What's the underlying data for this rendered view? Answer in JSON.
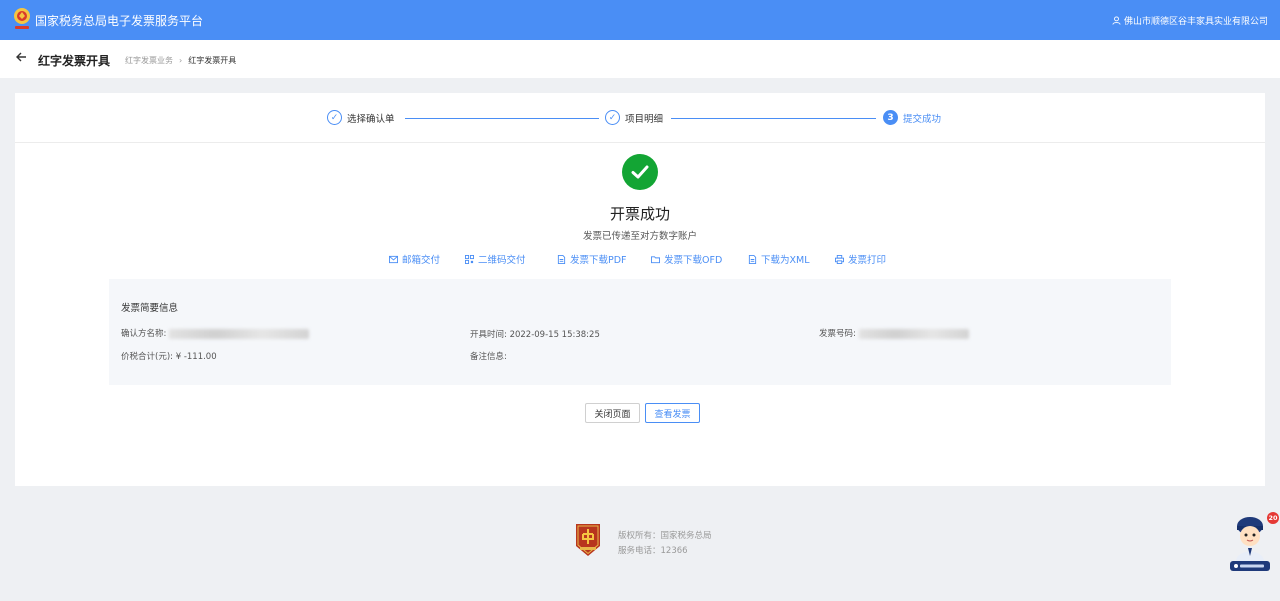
{
  "header": {
    "app_title": "国家税务总局电子发票服务平台",
    "user_company": "佛山市顺德区谷丰家具实业有限公司",
    "bg_color": "#4a8ef5"
  },
  "subheader": {
    "page_title": "红字发票开具",
    "breadcrumb": [
      "红字发票业务",
      "红字发票开具"
    ]
  },
  "steps": [
    {
      "label": "选择确认单",
      "state": "done"
    },
    {
      "label": "项目明细",
      "state": "done"
    },
    {
      "label": "提交成功",
      "state": "active",
      "index": "3"
    }
  ],
  "result": {
    "title": "开票成功",
    "subtitle": "发票已传递至对方数字账户",
    "accent_color": "#13a534"
  },
  "actions": [
    {
      "label": "邮箱交付",
      "icon": "mail-icon"
    },
    {
      "label": "二维码交付",
      "icon": "qrcode-icon"
    },
    {
      "label": "发票下载PDF",
      "icon": "document-icon"
    },
    {
      "label": "发票下载OFD",
      "icon": "folder-icon"
    },
    {
      "label": "下载为XML",
      "icon": "document-icon"
    },
    {
      "label": "发票打印",
      "icon": "printer-icon"
    }
  ],
  "invoice_info": {
    "title": "发票简要信息",
    "buyer_label": "确认方名称:",
    "issue_time_label": "开具时间:",
    "issue_time": "2022-09-15 15:38:25",
    "invoice_no_label": "发票号码:",
    "total_label": "价税合计(元):",
    "total_value": "¥ -111.00",
    "remark_label": "备注信息:"
  },
  "buttons": {
    "close": "关闭页面",
    "view": "查看发票"
  },
  "footer": {
    "copyright": "版权所有：国家税务总局",
    "hotline": "服务电话：12366"
  },
  "assistant": {
    "badge": "20"
  }
}
